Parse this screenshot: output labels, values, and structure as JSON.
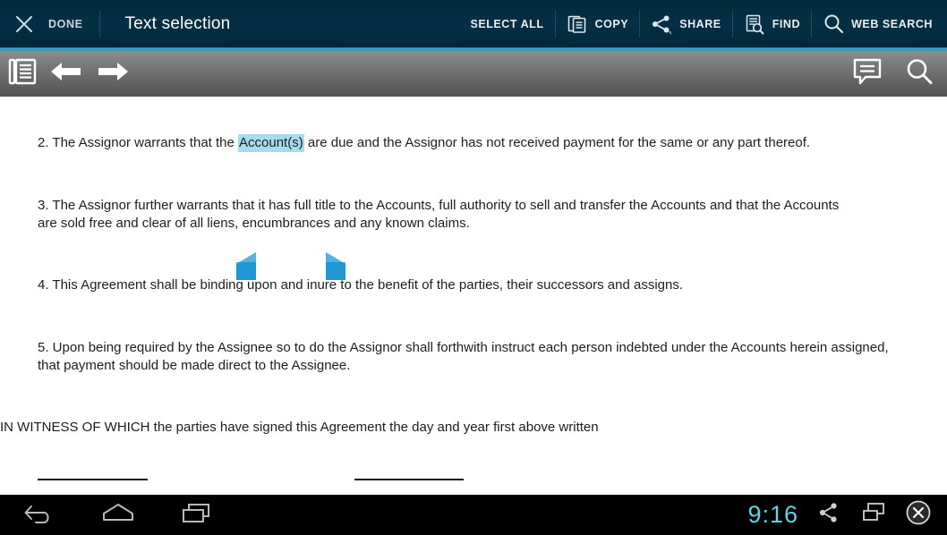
{
  "action_bar": {
    "close_icon": "close-x-icon",
    "done_label": "DONE",
    "title": "Text selection",
    "actions": [
      {
        "id": "select-all",
        "label": "SELECT ALL",
        "icon": null
      },
      {
        "id": "copy",
        "label": "COPY",
        "icon": "copy-pages-icon"
      },
      {
        "id": "share",
        "label": "SHARE",
        "icon": "share-nodes-icon"
      },
      {
        "id": "find",
        "label": "FIND",
        "icon": "document-find-icon"
      },
      {
        "id": "web-search",
        "label": "WEB SEARCH",
        "icon": "magnifier-icon"
      }
    ],
    "accent_color": "#3ea8ca",
    "background_color": "#042f44"
  },
  "toolbar": {
    "book_icon": "book-contents-icon",
    "back_icon": "arrow-left-icon",
    "forward_icon": "arrow-right-icon",
    "comment_icon": "comment-bubble-icon",
    "search_icon": "magnifier-icon"
  },
  "document": {
    "paragraph_2_before": "2. The Assignor warrants that the ",
    "selected_text": "Account(s)",
    "paragraph_2_after": " are due and the Assignor has not received payment for the same or any part thereof.",
    "paragraph_3": "3. The Assignor further warrants that it has full title to the Accounts, full authority to sell and transfer the Accounts and that the Accounts are sold free and clear of all liens, encumbrances and any known claims.",
    "paragraph_4": "4. This Agreement shall be binding upon and inure to the benefit of the parties, their successors and assigns.",
    "paragraph_5": "5. Upon being required by the Assignee so to do the Assignor shall forthwith instruct each person indebted under the Accounts herein assigned, that payment should be made direct to the Assignee.",
    "witness_line": "IN WITNESS OF WHICH the parties have signed this Agreement the day and year first above written",
    "signature_line_left": "________________",
    "signature_line_right": "_______________",
    "selection_highlight_color": "#a5dcf0",
    "selection_handle_color": "#2196d4"
  },
  "nav_bar": {
    "back_icon": "nav-back-icon",
    "home_icon": "nav-home-icon",
    "recents_icon": "nav-recents-icon",
    "clock": "9:16",
    "clock_color": "#5fd3e8",
    "share_icon": "share-nodes-icon",
    "screen-mirror_icon": "screen-mirror-icon",
    "close_icon": "close-circle-icon"
  }
}
